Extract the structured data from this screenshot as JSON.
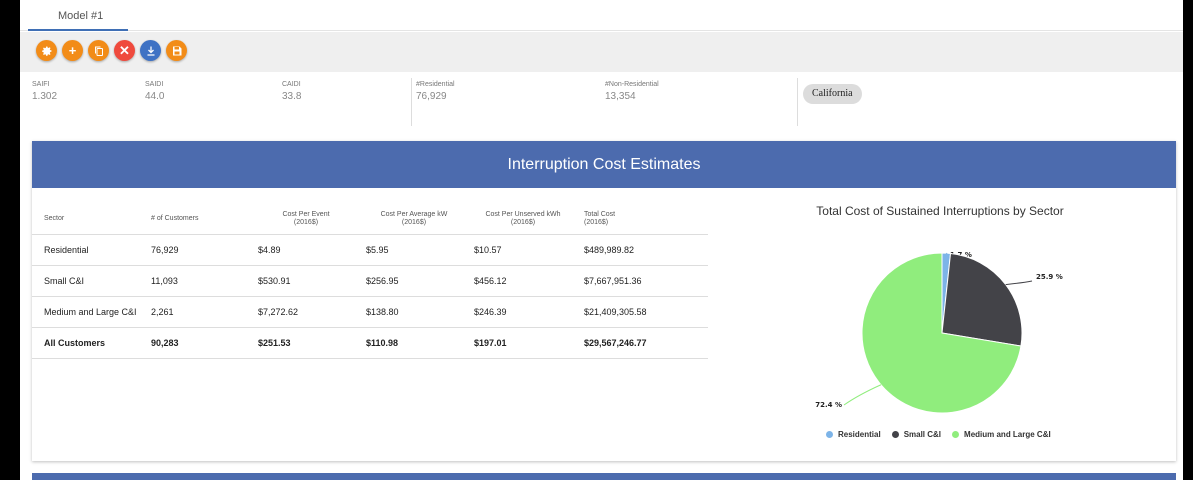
{
  "tab": {
    "label": "Model #1"
  },
  "toolbar": {
    "buttons": [
      {
        "name": "settings",
        "color": "#f28c18"
      },
      {
        "name": "add",
        "symbol": "+",
        "color": "#f28c18"
      },
      {
        "name": "copy",
        "color": "#f28c18"
      },
      {
        "name": "delete",
        "symbol": "✕",
        "color": "#ef4a3d"
      },
      {
        "name": "download",
        "color": "#3f72c4"
      },
      {
        "name": "save",
        "color": "#f28c18"
      }
    ]
  },
  "stats": {
    "saifi": {
      "label": "SAIFI",
      "value": "1.302"
    },
    "saidi": {
      "label": "SAIDI",
      "value": "44.0"
    },
    "caidi": {
      "label": "CAIDI",
      "value": "33.8"
    },
    "residential": {
      "label": "#Residential",
      "value": "76,929"
    },
    "nonresidential": {
      "label": "#Non-Residential",
      "value": "13,354"
    },
    "region": "California"
  },
  "card": {
    "title": "Interruption Cost Estimates"
  },
  "table": {
    "headers": [
      "Sector",
      "# of Customers",
      "Cost Per Event\n(2016$)",
      "Cost Per Average kW\n(2016$)",
      "Cost Per Unserved kWh\n(2016$)",
      "Total Cost\n(2016$)"
    ],
    "rows": [
      [
        "Residential",
        "76,929",
        "$4.89",
        "$5.95",
        "$10.57",
        "$489,989.82"
      ],
      [
        "Small C&I",
        "11,093",
        "$530.91",
        "$256.95",
        "$456.12",
        "$7,667,951.36"
      ],
      [
        "Medium and Large C&I",
        "2,261",
        "$7,272.62",
        "$138.80",
        "$246.39",
        "$21,409,305.58"
      ],
      [
        "All Customers",
        "90,283",
        "$251.53",
        "$110.98",
        "$197.01",
        "$29,567,246.77"
      ]
    ]
  },
  "chart_data": {
    "type": "pie",
    "title": "Total Cost of Sustained Interruptions by Sector",
    "categories": [
      "Residential",
      "Small C&I",
      "Medium and Large C&I"
    ],
    "values": [
      1.7,
      25.9,
      72.4
    ],
    "labels": [
      "1.7 %",
      "25.9 %",
      "72.4 %"
    ],
    "colors": [
      "#7db4e8",
      "#434348",
      "#90ed7d"
    ],
    "legend_position": "bottom"
  }
}
